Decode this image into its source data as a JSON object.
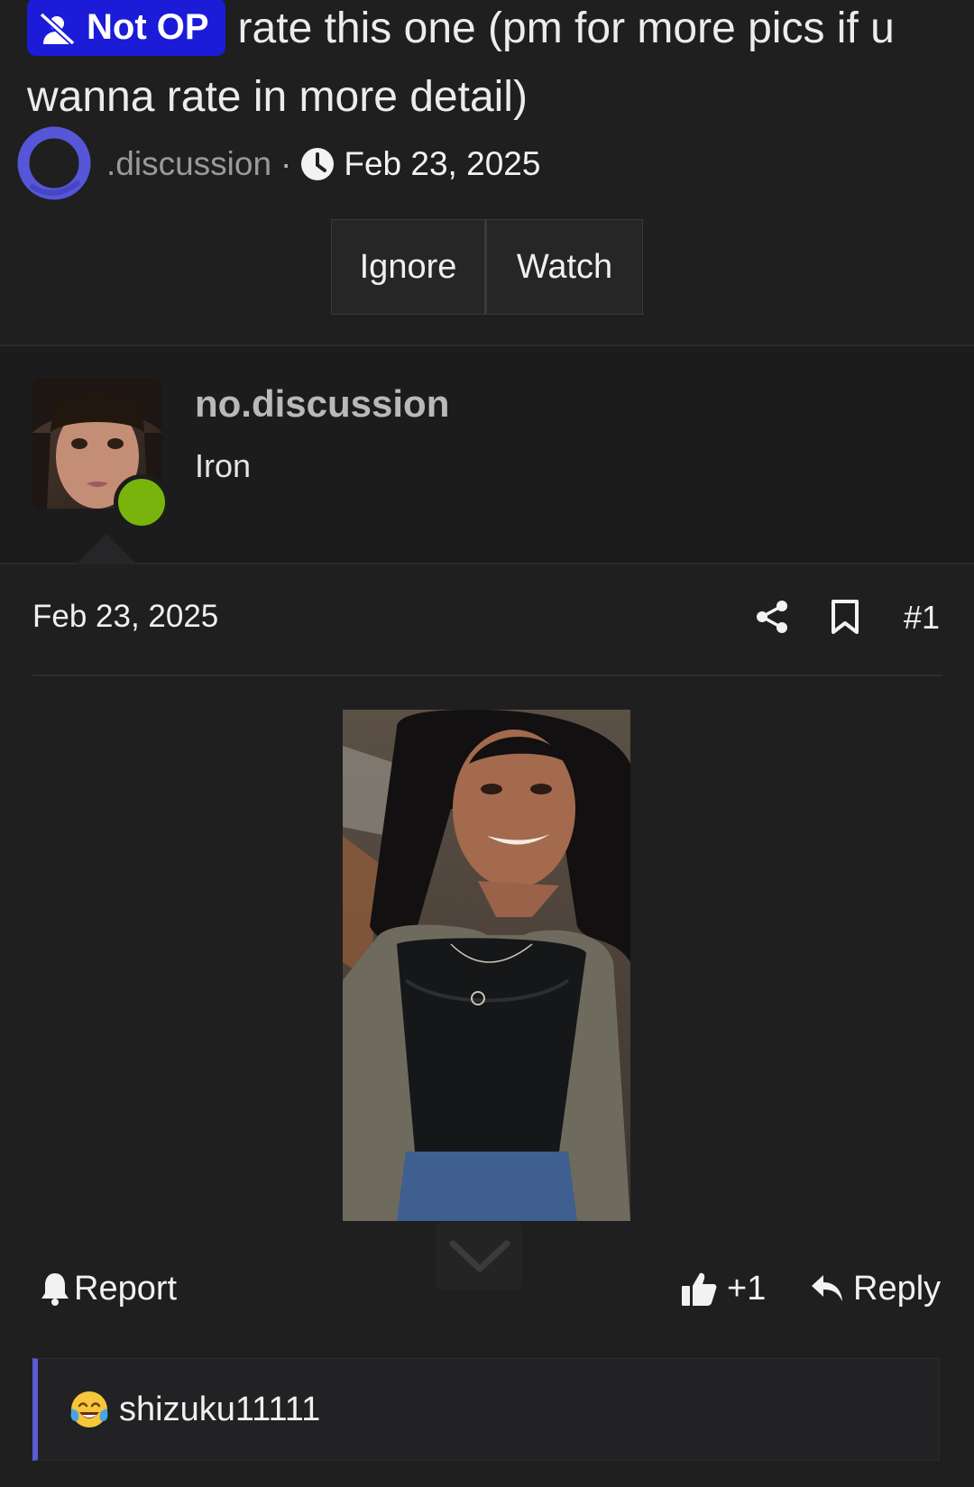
{
  "thread": {
    "prefix": "Not OP",
    "prefix_icon": "user-slash-icon",
    "title": "rate this one (pm for more pics if u wanna rate in more detail)",
    "author": ".discussion",
    "separator": "·",
    "date": "Feb 23, 2025",
    "buttons": {
      "ignore": "Ignore",
      "watch": "Watch"
    }
  },
  "post": {
    "username": "no.discussion",
    "user_title": "Iron",
    "online": true,
    "date": "Feb 23, 2025",
    "post_number": "#1",
    "actions": {
      "report": "Report",
      "like": "+1",
      "reply": "Reply"
    },
    "reactions": {
      "emoji": "joy-tears-icon",
      "user": "shizuku11111"
    }
  },
  "colors": {
    "background": "#1f1f20",
    "prefix_badge": "#1b1bd8",
    "online": "#78b40b",
    "accent": "#5b5bd6"
  }
}
